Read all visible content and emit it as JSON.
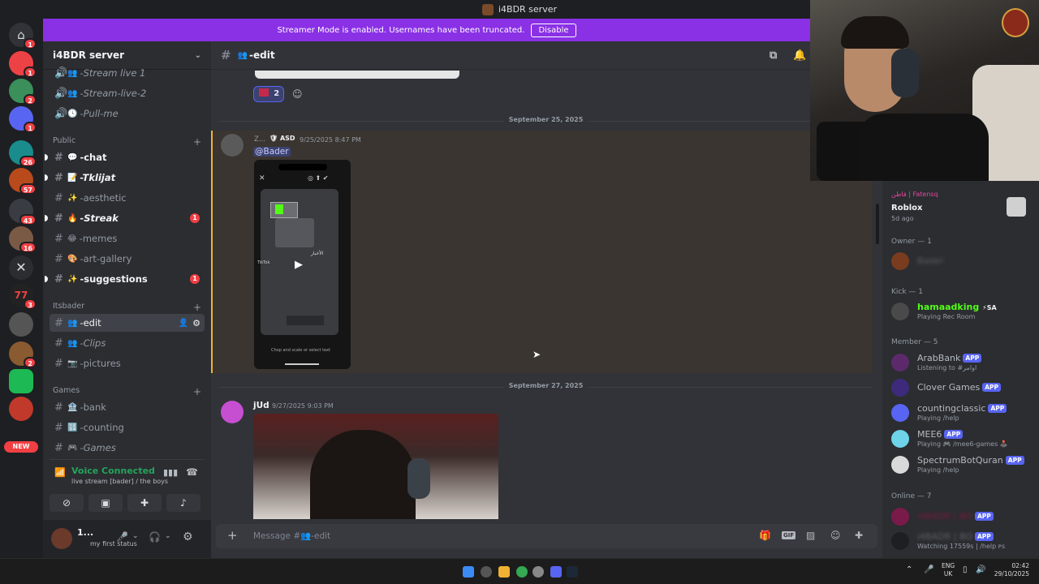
{
  "window": {
    "title": "i4BDR server"
  },
  "banner": {
    "text": "Streamer Mode is enabled. Usernames have been truncated.",
    "button": "Disable"
  },
  "rail": {
    "badges": [
      "1",
      "1",
      "2",
      "1",
      "26",
      "57",
      "43",
      "16",
      "3",
      "2"
    ],
    "new_label": "NEW"
  },
  "guild": {
    "name": "i4BDR server"
  },
  "channels": {
    "top": [
      "-Stream live 1",
      "-Stream-live-2",
      "-Pull-me"
    ],
    "cat_public": "Public",
    "public": [
      {
        "emoji": "💬",
        "name": "-chat",
        "badge": ""
      },
      {
        "emoji": "📝",
        "name": "-Tklijat",
        "badge": ""
      },
      {
        "emoji": "✨",
        "name": "-aesthetic",
        "badge": ""
      },
      {
        "emoji": "🔥",
        "name": "-Streak",
        "badge": "1"
      },
      {
        "emoji": "😂",
        "name": "-memes",
        "badge": ""
      },
      {
        "emoji": "🎨",
        "name": "-art-gallery",
        "badge": ""
      },
      {
        "emoji": "✨",
        "name": "-suggestions",
        "badge": "1"
      }
    ],
    "cat_itsbader": "Itsbader",
    "itsbader": [
      {
        "emoji": "👥",
        "name": "-edit"
      },
      {
        "emoji": "👥",
        "name": "-Clips"
      },
      {
        "emoji": "📷",
        "name": "-pictures"
      }
    ],
    "cat_games": "Games",
    "games": [
      {
        "emoji": "🏦",
        "name": "-bank"
      },
      {
        "emoji": "🔢",
        "name": "-counting"
      },
      {
        "emoji": "🎮",
        "name": "-Games"
      }
    ]
  },
  "voice": {
    "status": "Voice Connected",
    "channel": "live stream [bader] / the boys"
  },
  "user": {
    "name": "1...",
    "status": "my first status"
  },
  "chat": {
    "channel": "-edit",
    "reaction_count": "2",
    "date1": "September 25, 2025",
    "msg1": {
      "author": "Z...",
      "tag": "ASD",
      "time": "9/25/2025 8:47 PM",
      "mention": "@Bader"
    },
    "phone": {
      "caption": "Chop and scale or select text",
      "arabic": "الأخبار"
    },
    "date2": "September 27, 2025",
    "msg2": {
      "author": "jUd",
      "time": "9/27/2025 9:03 PM"
    },
    "placeholder": "Message #👥-edit"
  },
  "members": {
    "activity_top": {
      "name": "فاطن | Fatensq",
      "game": "Roblox",
      "ago": "5d ago"
    },
    "owner_label": "Owner — 1",
    "owner_name": "Bader",
    "kick_label": "Kick — 1",
    "kick": {
      "name": "hamaadking",
      "tag": "SA",
      "activity": "Playing Rec Room"
    },
    "member_label": "Member — 5",
    "member_list": [
      {
        "name": "ArabBank",
        "activity": "Listening to #اوامر"
      },
      {
        "name": "Clover Games",
        "activity": ""
      },
      {
        "name": "countingclassic",
        "activity": "Playing /help"
      },
      {
        "name": "MEE6",
        "activity": "Playing 🎮 /mee6-games 🕹️"
      },
      {
        "name": "SpectrumBotQuran",
        "activity": "Playing /help"
      }
    ],
    "online_label": "Online — 7",
    "online_list": [
      {
        "name": "i4BADR | BO",
        "activity": ""
      },
      {
        "name": "i4BADR | BO",
        "activity": "Watching 17559s | /help ᴘꜱ"
      }
    ],
    "app_label": "APP"
  },
  "taskbar": {
    "lang1": "ENG",
    "lang2": "UK",
    "time": "02:42",
    "date": "29/10/2025"
  },
  "colors": {
    "accent": "#5865f2",
    "banner": "#8a30e5",
    "online": "#23a55a",
    "badge": "#f23f43"
  }
}
